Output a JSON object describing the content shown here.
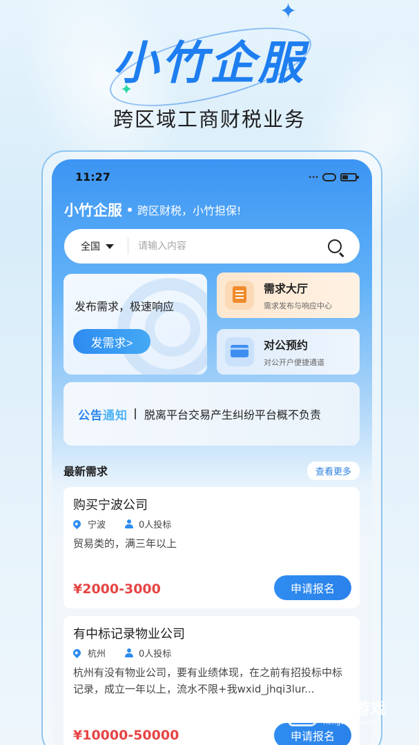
{
  "promo": {
    "title": "小竹企服",
    "subtitle": "跨区域工商财税业务"
  },
  "status_bar": {
    "time": "11:27"
  },
  "brand": {
    "name": "小竹企服",
    "slogan": "跨区财税，小竹担保!"
  },
  "search": {
    "region": "全国",
    "placeholder": "请输入内容"
  },
  "post_card": {
    "text": "发布需求，极速响应",
    "button_label": "发需求>"
  },
  "features": [
    {
      "title": "需求大厅",
      "desc": "需求发布与响应中心",
      "icon": "clipboard-icon"
    },
    {
      "title": "对公预约",
      "desc": "对公开户便捷通道",
      "icon": "bank-card-icon"
    }
  ],
  "notice": {
    "label_part1": "公告",
    "label_part2": "通知",
    "text": "脱离平台交易产生纠纷平台概不负责"
  },
  "section": {
    "title": "最新需求",
    "more_label": "查看更多"
  },
  "demands": [
    {
      "title": "购买宁波公司",
      "city": "宁波",
      "bids": "0人投标",
      "desc": "贸易类的，满三年以上",
      "price": "¥2000-3000",
      "button_label": "申请报名"
    },
    {
      "title": "有中标记录物业公司",
      "city": "杭州",
      "bids": "0人投标",
      "desc": "杭州有没有物业公司，要有业绩体现，在之前有招投标中标记录，成立一年以上，流水不限+我wxid_jhqi3lur...",
      "price": "¥10000-50000",
      "button_label": "申请报名"
    }
  ],
  "watermark": {
    "main": "仍玩游戏",
    "sub": "Rengwan Games"
  }
}
